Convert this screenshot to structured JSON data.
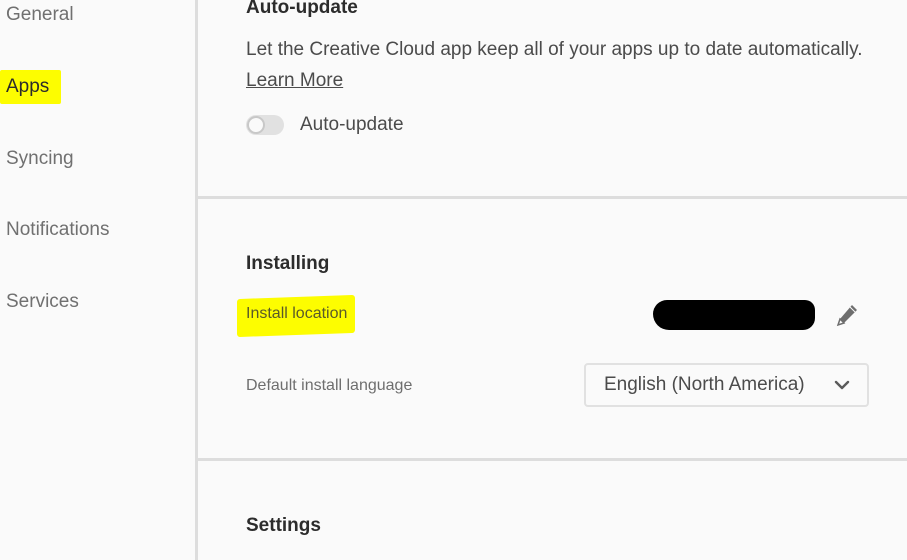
{
  "sidebar": {
    "items": [
      {
        "label": "General",
        "active": false
      },
      {
        "label": "Apps",
        "active": true
      },
      {
        "label": "Syncing",
        "active": false
      },
      {
        "label": "Notifications",
        "active": false
      },
      {
        "label": "Services",
        "active": false
      }
    ]
  },
  "auto_update": {
    "heading": "Auto-update",
    "description": "Let the Creative Cloud app keep all of your apps up to date automatically.",
    "learn_more": "Learn More",
    "toggle_label": "Auto-update",
    "toggle_on": false
  },
  "installing": {
    "heading": "Installing",
    "install_location_label": "Install location",
    "install_location_value": "[redacted]",
    "edit_icon": "pencil-icon",
    "language_label": "Default install language",
    "language_value": "English (North America)",
    "dropdown_icon": "chevron-down-icon"
  },
  "settings": {
    "heading": "Settings"
  },
  "colors": {
    "highlight": "#fdfd00",
    "divider": "#dddddd",
    "background": "#fafafa"
  }
}
